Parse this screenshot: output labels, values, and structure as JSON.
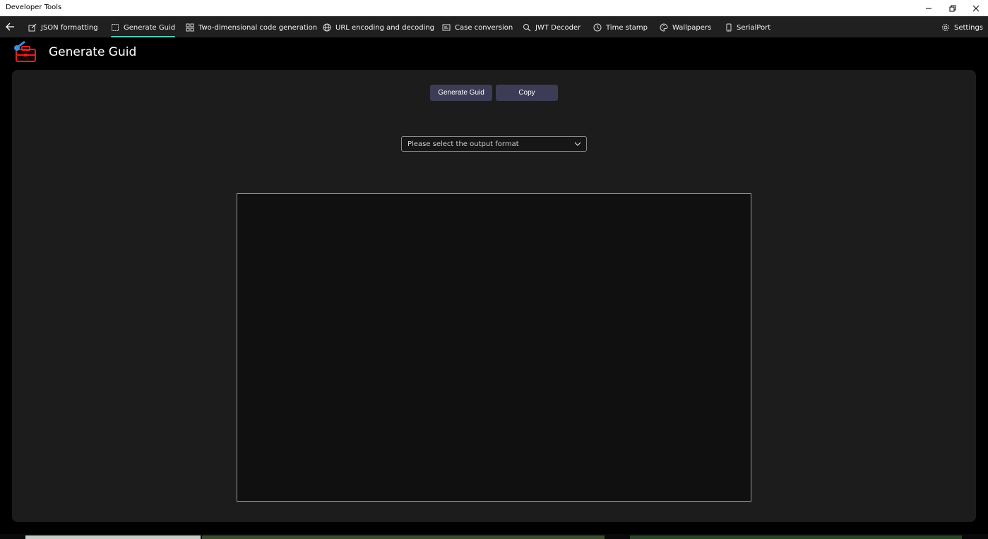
{
  "window": {
    "title": "Developer Tools"
  },
  "nav": {
    "items": [
      {
        "label": "JSON formatting",
        "icon": "edit-icon"
      },
      {
        "label": "Generate Guid",
        "icon": "square-icon",
        "active": true
      },
      {
        "label": "Two-dimensional code generation",
        "icon": "qr-code-icon"
      },
      {
        "label": "URL encoding and decoding",
        "icon": "globe-icon"
      },
      {
        "label": "Case conversion",
        "icon": "case-icon"
      },
      {
        "label": "JWT Decoder",
        "icon": "search-icon"
      },
      {
        "label": "Time stamp",
        "icon": "clock-icon"
      },
      {
        "label": "Wallpapers",
        "icon": "palette-icon"
      },
      {
        "label": "SerialPort",
        "icon": "phone-icon"
      }
    ],
    "settings_label": "Settings"
  },
  "page": {
    "title": "Generate Guid"
  },
  "actions": {
    "generate_label": "Generate Guid",
    "copy_label": "Copy"
  },
  "format_select": {
    "placeholder": "Please select the output format"
  },
  "output": {
    "value": ""
  },
  "colors": {
    "accent": "#5cc8b6",
    "button": "#3c3c56",
    "panel": "#1c1c1c"
  }
}
